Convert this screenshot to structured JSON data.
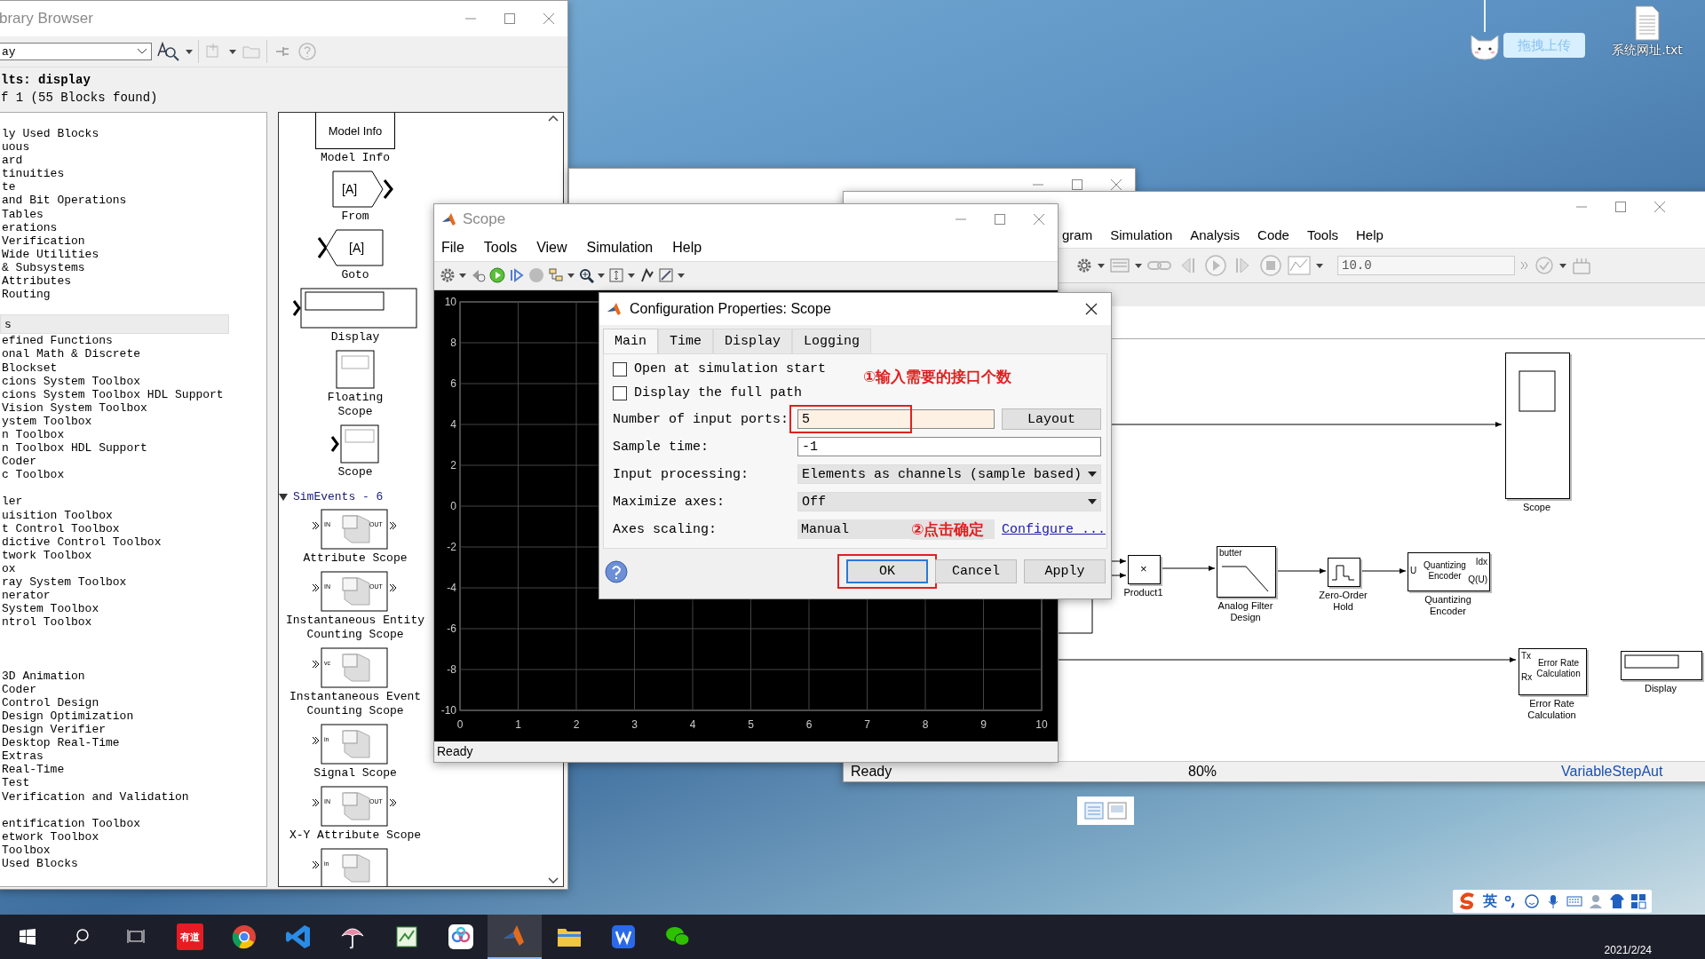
{
  "desktop": {
    "upload_widget": {
      "button": "拖拽上传"
    },
    "icons": [
      {
        "label": "系统网址.txt"
      }
    ]
  },
  "library_browser": {
    "title": "brary Browser",
    "search": {
      "value": "ay"
    },
    "results_heading": "lts: display",
    "results_count": "f 1 (55 Blocks found)",
    "tree_groups": [
      [
        {
          "label": "ly Used Blocks",
          "selected": false
        },
        {
          "label": "uous",
          "selected": false
        },
        {
          "label": "ard",
          "selected": false
        },
        {
          "label": "tinuities",
          "selected": false
        },
        {
          "label": "te",
          "selected": false
        },
        {
          "label": "and Bit Operations",
          "selected": false
        },
        {
          "label": "Tables",
          "selected": false
        },
        {
          "label": "erations",
          "selected": false
        },
        {
          "label": "Verification",
          "selected": false
        },
        {
          "label": "Wide Utilities",
          "selected": false
        },
        {
          "label": "& Subsystems",
          "selected": false
        },
        {
          "label": "Attributes",
          "selected": false
        },
        {
          "label": "Routing",
          "selected": false
        }
      ],
      [
        {
          "label": "s",
          "selected": true
        },
        {
          "label": "efined Functions",
          "selected": false
        },
        {
          "label": "onal Math & Discrete",
          "selected": false
        },
        {
          "label": "Blockset",
          "selected": false
        },
        {
          "label": "cions System Toolbox",
          "selected": false
        },
        {
          "label": "cions System Toolbox HDL Support",
          "selected": false
        },
        {
          "label": "Vision System Toolbox",
          "selected": false
        },
        {
          "label": "ystem Toolbox",
          "selected": false
        },
        {
          "label": "n Toolbox",
          "selected": false
        },
        {
          "label": "n Toolbox HDL Support",
          "selected": false
        },
        {
          "label": "Coder",
          "selected": false
        },
        {
          "label": "c Toolbox",
          "selected": false
        }
      ],
      [
        {
          "label": "ler",
          "selected": false
        },
        {
          "label": "uisition Toolbox",
          "selected": false
        },
        {
          "label": "t Control Toolbox",
          "selected": false
        },
        {
          "label": "dictive Control Toolbox",
          "selected": false
        },
        {
          "label": "twork Toolbox",
          "selected": false
        },
        {
          "label": "ox",
          "selected": false
        },
        {
          "label": "ray System Toolbox",
          "selected": false
        },
        {
          "label": "nerator",
          "selected": false
        },
        {
          "label": "System Toolbox",
          "selected": false
        },
        {
          "label": "ntrol Toolbox",
          "selected": false
        }
      ],
      [
        {
          "label": "3D Animation",
          "selected": false
        },
        {
          "label": "Coder",
          "selected": false
        },
        {
          "label": "Control Design",
          "selected": false
        },
        {
          "label": "Design Optimization",
          "selected": false
        },
        {
          "label": "Design Verifier",
          "selected": false
        },
        {
          "label": "Desktop Real-Time",
          "selected": false
        },
        {
          "label": "Extras",
          "selected": false
        },
        {
          "label": "Real-Time",
          "selected": false
        },
        {
          "label": "Test",
          "selected": false
        },
        {
          "label": "Verification and Validation",
          "selected": false
        }
      ],
      [
        {
          "label": "entification Toolbox",
          "selected": false
        },
        {
          "label": "etwork Toolbox",
          "selected": false
        },
        {
          "label": "Toolbox",
          "selected": false
        },
        {
          "label": "Used Blocks",
          "selected": false
        }
      ]
    ],
    "blocks": [
      {
        "kind": "model-info",
        "icon_text": "Model Info",
        "label": "Model Info"
      },
      {
        "kind": "from",
        "icon_text": "[A]",
        "label": "From"
      },
      {
        "kind": "goto",
        "icon_text": "[A]",
        "label": "Goto"
      },
      {
        "kind": "display",
        "label": "Display"
      },
      {
        "kind": "floating-scope",
        "label": "Floating Scope"
      },
      {
        "kind": "scope",
        "label": "Scope"
      },
      {
        "kind": "section",
        "label": "SimEvents - 6",
        "expanded": true
      },
      {
        "kind": "event-scope",
        "in": "IN",
        "out": "OUT",
        "label": "Attribute Scope"
      },
      {
        "kind": "event-scope",
        "in": "IN",
        "out": "OUT",
        "label": "Instantaneous Entity Counting Scope"
      },
      {
        "kind": "event-scope",
        "in": "vc",
        "label": "Instantaneous Event Counting Scope"
      },
      {
        "kind": "event-scope",
        "in": "in",
        "label": "Signal Scope"
      },
      {
        "kind": "event-scope",
        "in": "IN",
        "out": "OUT",
        "label": "X-Y Attribute Scope"
      },
      {
        "kind": "event-scope",
        "in": "in"
      }
    ]
  },
  "scope_window": {
    "title": "Scope",
    "menu": [
      "File",
      "Tools",
      "View",
      "Simulation",
      "Help"
    ],
    "chart_data": {
      "type": "line",
      "grid": true,
      "xlim": [
        0,
        10
      ],
      "ylim": [
        -10,
        10
      ],
      "xticks": [
        0,
        1,
        2,
        3,
        4,
        5,
        6,
        7,
        8,
        9,
        10
      ],
      "yticks": [
        -10,
        -8,
        -6,
        -4,
        -2,
        0,
        2,
        4,
        6,
        8,
        10
      ]
    },
    "status": "Ready"
  },
  "config_dialog": {
    "title": "Configuration Properties: Scope",
    "tabs": [
      {
        "label": "Main",
        "selected": true
      },
      {
        "label": "Time",
        "selected": false
      },
      {
        "label": "Display",
        "selected": false
      },
      {
        "label": "Logging",
        "selected": false
      }
    ],
    "checkboxes": [
      {
        "label": "Open at simulation start",
        "checked": false
      },
      {
        "label": "Display the full path",
        "checked": false
      }
    ],
    "fields": [
      {
        "kind": "text",
        "label": "Number of input ports:",
        "value": "5",
        "focused": true,
        "highlighted": true,
        "button": "Layout"
      },
      {
        "kind": "text",
        "label": "Sample time:",
        "value": "-1",
        "focused": false,
        "highlighted": false
      },
      {
        "kind": "select",
        "label": "Input processing:",
        "value": "Elements as channels (sample based)"
      },
      {
        "kind": "select",
        "label": "Maximize axes:",
        "value": "Off"
      },
      {
        "kind": "readonly",
        "label": "Axes scaling:",
        "value": "Manual",
        "link": "Configure ..."
      }
    ],
    "annotations": [
      "①输入需要的接口个数",
      "②点击确定"
    ],
    "buttons": [
      {
        "label": "OK",
        "default": true,
        "highlighted": true
      },
      {
        "label": "Cancel",
        "default": false,
        "highlighted": false
      },
      {
        "label": "Apply",
        "default": false,
        "highlighted": false
      }
    ]
  },
  "simulink_window": {
    "menu": [
      "gram",
      "Simulation",
      "Analysis",
      "Code",
      "Tools",
      "Help"
    ],
    "stop_time": "10.0",
    "blocks": [
      {
        "kind": "scope",
        "label": "Scope"
      },
      {
        "kind": "product",
        "glyph": "×",
        "label": "Product1"
      },
      {
        "kind": "filter",
        "text": "butter",
        "label": "Analog Filter Design"
      },
      {
        "kind": "zoh",
        "label": "Zero-Order Hold"
      },
      {
        "kind": "encoder",
        "text": "Quantizing Encoder",
        "ports_in": [
          "U"
        ],
        "ports_out": [
          "Idx",
          "Q(U)"
        ],
        "label": "Quantizing Encoder"
      },
      {
        "kind": "error-rate",
        "text": "Error Rate Calculation",
        "ports_in": [
          "Tx",
          "Rx"
        ],
        "label": "Error Rate Calculation"
      },
      {
        "kind": "display",
        "label": "Display"
      }
    ],
    "status": [
      "Ready",
      "80%",
      "VariableStepAut"
    ]
  },
  "ime_bar": {
    "mode": "英"
  },
  "taskbar": {
    "apps": [
      {
        "kind": "dict",
        "label": "有道",
        "active": false
      },
      {
        "kind": "chrome",
        "active": false
      },
      {
        "kind": "vscode",
        "active": false
      },
      {
        "kind": "umbrella",
        "active": false
      },
      {
        "kind": "sheet",
        "active": false
      },
      {
        "kind": "cloud",
        "active": false
      },
      {
        "kind": "matlab",
        "active": true
      },
      {
        "kind": "folder",
        "active": false
      },
      {
        "kind": "wps",
        "active": false
      },
      {
        "kind": "wechat",
        "active": false
      }
    ],
    "date": "2021/2/24"
  }
}
